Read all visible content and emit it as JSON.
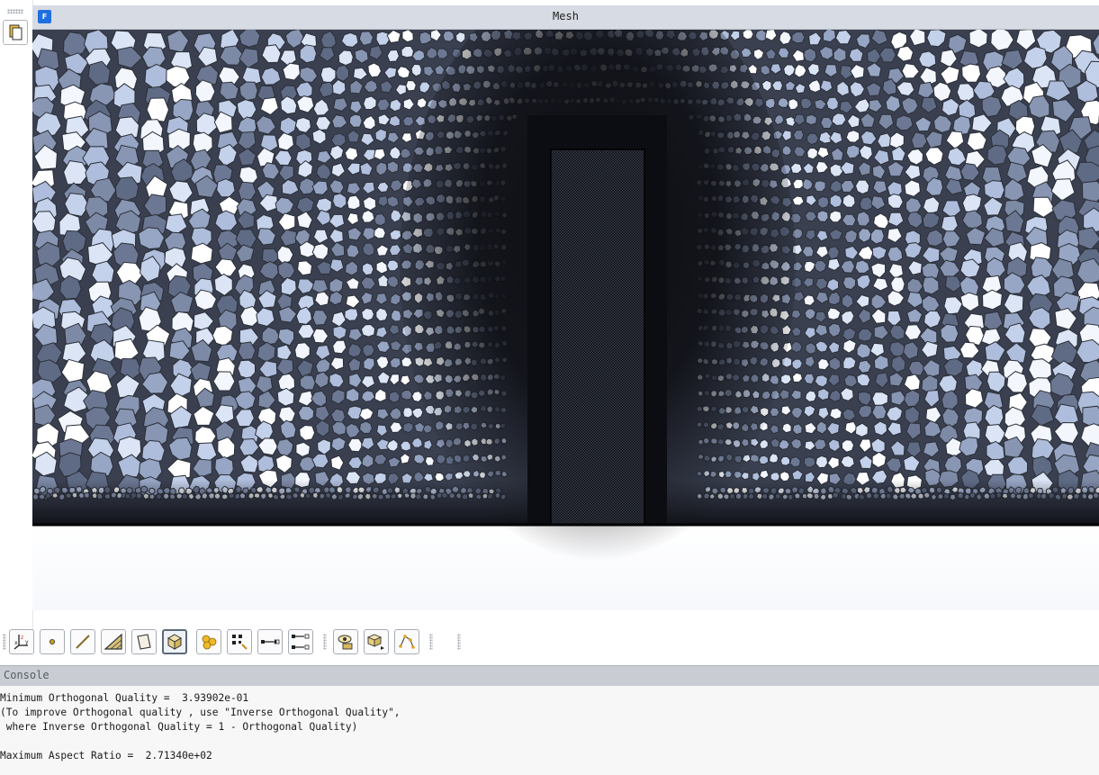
{
  "window": {
    "title": "Mesh",
    "app_icon_letter": "F"
  },
  "mesh": {
    "fill_color": "#a9b8d6",
    "light_cell_color": "#ffffff",
    "edge_color": "#2b2f38",
    "dense_color": "#0c0d12"
  },
  "toolbar": {
    "buttons": [
      {
        "name": "axes-icon",
        "label": "Axes"
      },
      {
        "name": "point-icon",
        "label": "Points"
      },
      {
        "name": "edge-icon",
        "label": "Edges"
      },
      {
        "name": "triangle-face-icon",
        "label": "Faces"
      },
      {
        "name": "quad-face-icon",
        "label": "Faces"
      },
      {
        "name": "cube-icon",
        "label": "Cells"
      },
      {
        "name": "polyhedra-icon",
        "label": "Polyhedra"
      },
      {
        "name": "pick-nodes-icon",
        "label": "Pick"
      },
      {
        "name": "connect-icon",
        "label": "Connect"
      },
      {
        "name": "connect-multi-icon",
        "label": "Connect"
      },
      {
        "name": "view-zone-icon",
        "label": "Zone"
      },
      {
        "name": "cell-zone-icon",
        "label": "Cell zone"
      },
      {
        "name": "pick-path-icon",
        "label": "Path"
      }
    ],
    "active_index": 5
  },
  "console": {
    "title": "Console",
    "lines": [
      "Minimum Orthogonal Quality =  3.93902e-01",
      "(To improve Orthogonal quality , use \"Inverse Orthogonal Quality\",",
      " where Inverse Orthogonal Quality = 1 - Orthogonal Quality)",
      "",
      "Maximum Aspect Ratio =  2.71340e+02"
    ]
  }
}
